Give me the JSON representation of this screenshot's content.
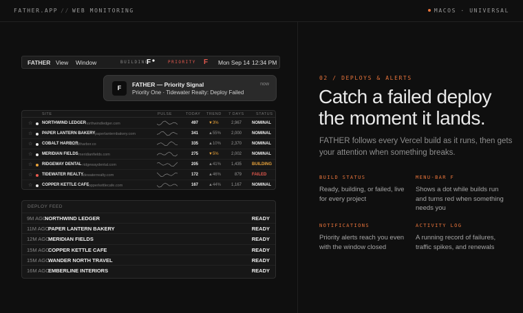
{
  "topbar": {
    "brand": "FATHER.APP",
    "separator": "//",
    "section": "WEB MONITORING",
    "platform": "MACOS · UNIVERSAL"
  },
  "menubar": {
    "app": "FATHER",
    "view": "View",
    "window": "Window",
    "building_label": "BUILDING",
    "f_glyph": "F",
    "priority_label": "PRIORITY",
    "f_glyph_alert": "F",
    "date": "Mon Sep 14",
    "time": "12:34 PM"
  },
  "notification": {
    "icon": "F",
    "title": "FATHER — Priority Signal",
    "body": "Priority One · Tidewater Realty: Deploy Failed",
    "time": "now"
  },
  "sites": {
    "headers": {
      "site": "SITE",
      "pulse": "PULSE",
      "today": "TODAY",
      "trend": "TREND",
      "days": "7 DAYS",
      "status": "STATUS"
    },
    "rows": [
      {
        "name": "NORTHWIND LEDGER",
        "domain": "northwindledger.com",
        "today": "497",
        "trend": "▼3%",
        "days": "2,967",
        "status": "NOMINAL",
        "dot": "#e8e8e8",
        "trend_up": true,
        "status_kind": ""
      },
      {
        "name": "PAPER LANTERN BAKERY",
        "domain": "paperlanternbakery.com",
        "today": "341",
        "trend": "▲55%",
        "days": "2,000",
        "status": "NOMINAL",
        "dot": "#e8e8e8",
        "trend_up": false,
        "status_kind": ""
      },
      {
        "name": "COBALT HARBOR",
        "domain": "cobaltharbor.co",
        "today": "335",
        "trend": "▲10%",
        "days": "2,370",
        "status": "NOMINAL",
        "dot": "#e8e8e8",
        "trend_up": false,
        "status_kind": ""
      },
      {
        "name": "MERIDIAN FIELDS",
        "domain": "meridianfields.com",
        "today": "275",
        "trend": "▼5%",
        "days": "2,002",
        "status": "NOMINAL",
        "dot": "#e8e8e8",
        "trend_up": true,
        "status_kind": ""
      },
      {
        "name": "RIDGEWAY DENTAL",
        "domain": "ridgewaydental.com",
        "today": "205",
        "trend": "▲41%",
        "days": "1,435",
        "status": "BUILDING",
        "dot": "#e8a33b",
        "trend_up": false,
        "status_kind": "building"
      },
      {
        "name": "TIDEWATER REALTY",
        "domain": "tidewaterrealty.com",
        "today": "172",
        "trend": "▲46%",
        "days": "879",
        "status": "FAILED",
        "dot": "#e85a4f",
        "trend_up": false,
        "status_kind": "failed"
      },
      {
        "name": "COPPER KETTLE CAFE",
        "domain": "copperkettlecafe.com",
        "today": "167",
        "trend": "▲44%",
        "days": "1,167",
        "status": "NOMINAL",
        "dot": "#e8e8e8",
        "trend_up": false,
        "status_kind": ""
      }
    ]
  },
  "feed": {
    "title": "DEPLOY FEED",
    "rows": [
      {
        "ago": "9M AGO",
        "name": "NORTHWIND LEDGER",
        "status": "READY"
      },
      {
        "ago": "11M AGO",
        "name": "PAPER LANTERN BAKERY",
        "status": "READY"
      },
      {
        "ago": "12M AGO",
        "name": "MERIDIAN FIELDS",
        "status": "READY"
      },
      {
        "ago": "15M AGO",
        "name": "COPPER KETTLE CAFE",
        "status": "READY"
      },
      {
        "ago": "15M AGO",
        "name": "WANDER NORTH TRAVEL",
        "status": "READY"
      },
      {
        "ago": "16M AGO",
        "name": "EMBERLINE INTERIORS",
        "status": "READY"
      }
    ]
  },
  "hero": {
    "eyebrow": "02 / DEPLOYS & ALERTS",
    "headline": "Catch a failed deploy the moment it lands.",
    "lede": "FATHER follows every Vercel build as it runs, then gets your attention when something breaks."
  },
  "features": [
    {
      "title": "BUILD STATUS",
      "body": "Ready, building, or failed, live for every project"
    },
    {
      "title": "MENU-BAR F",
      "body": "Shows a dot while builds run and turns red when something needs you"
    },
    {
      "title": "NOTIFICATIONS",
      "body": "Priority alerts reach you even with the window closed"
    },
    {
      "title": "ACTIVITY LOG",
      "body": "A running record of failures, traffic spikes, and renewals"
    }
  ],
  "colors": {
    "accent": "#e8743b",
    "alert": "#e85a4f",
    "building": "#e8a33b"
  }
}
